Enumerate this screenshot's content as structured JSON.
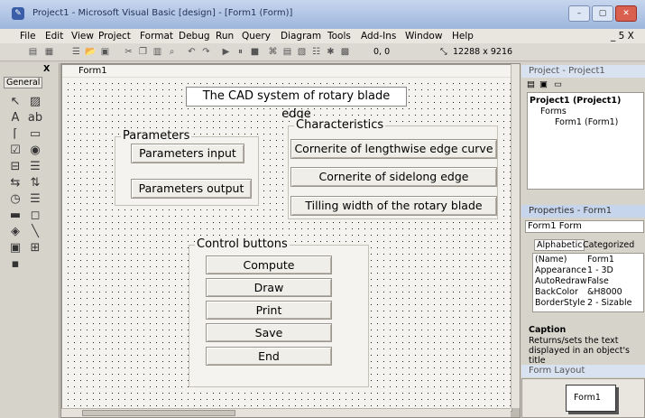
{
  "window": {
    "title": "Project1 - Microsoft Visual Basic [design] - [Form1 (Form)]",
    "icon": "vb-app-icon",
    "min": "–",
    "restore": "▢",
    "close": "✕"
  },
  "menu": {
    "items": [
      "File",
      "Edit",
      "View",
      "Project",
      "Format",
      "Debug",
      "Run",
      "Query",
      "Diagram",
      "Tools",
      "Add-Ins",
      "Window",
      "Help"
    ],
    "mdi_controls": "_ 5 X"
  },
  "toolbar": {
    "position": "0, 0",
    "size": "12288 x 9216"
  },
  "toolbox": {
    "tab": "General",
    "close": "X"
  },
  "form": {
    "title": "Form1",
    "heading": "The CAD system of rotary blade edge",
    "parameters": {
      "caption": "Parameters",
      "input": "Parameters input",
      "output": "Parameters output"
    },
    "characteristics": {
      "caption": "Characteristics",
      "b1": "Cornerite of lengthwise edge curve",
      "b2": "Cornerite of sidelong edge",
      "b3": "Tilling width of the rotary blade"
    },
    "controls": {
      "caption": "Control buttons",
      "compute": "Compute",
      "draw": "Draw",
      "print": "Print",
      "save": "Save",
      "end": "End"
    }
  },
  "project": {
    "title": "Project - Project1",
    "root": "Project1 (Project1)",
    "folder": "Forms",
    "item": "Form1 (Form1)"
  },
  "properties": {
    "title": "Properties - Form1",
    "object": "Form1 Form",
    "tab_alpha": "Alphabetic",
    "tab_cat": "Categorized",
    "rows": [
      [
        "(Name)",
        "Form1"
      ],
      [
        "Appearance",
        "1 - 3D"
      ],
      [
        "AutoRedraw",
        "False"
      ],
      [
        "BackColor",
        "&H8000"
      ],
      [
        "BorderStyle",
        "2 - Sizable"
      ]
    ],
    "desc_title": "Caption",
    "desc_text": "Returns/sets the text displayed in an object's title"
  },
  "layout": {
    "title": "Form Layout",
    "form": "Form1"
  }
}
